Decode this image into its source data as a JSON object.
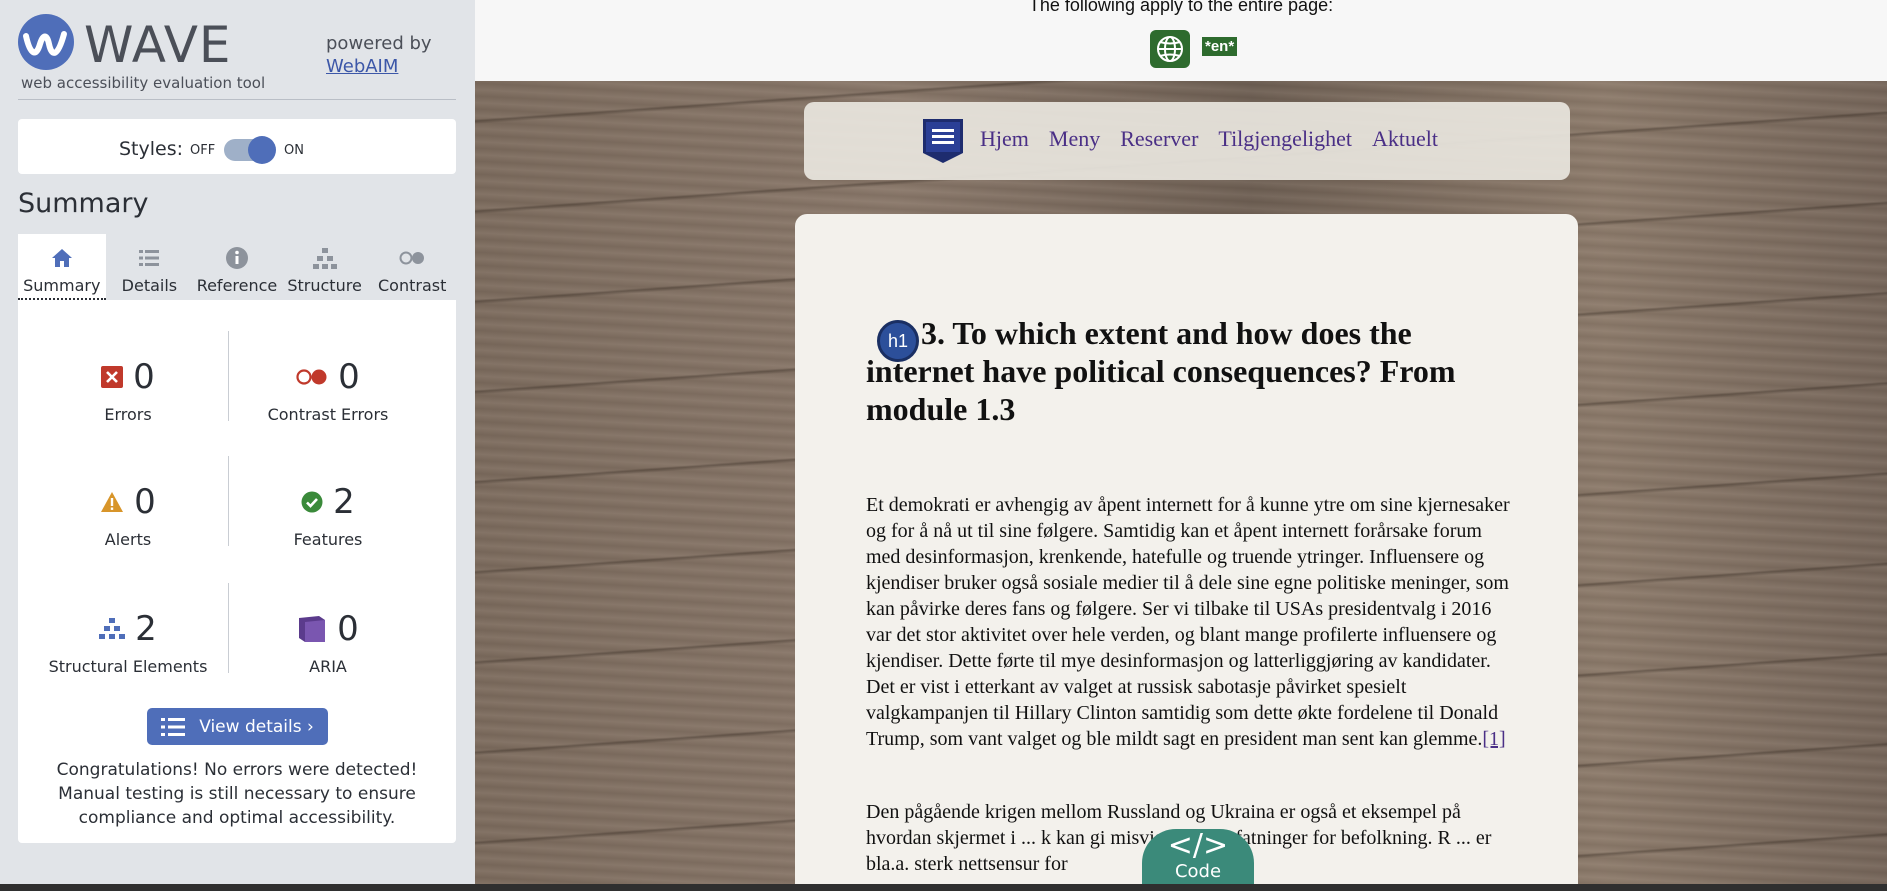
{
  "wave": {
    "logo_text": "WAVE",
    "tagline": "web accessibility evaluation tool",
    "powered_by": "powered by",
    "webaim_link": "WebAIM"
  },
  "styles": {
    "label": "Styles:",
    "off": "OFF",
    "on": "ON",
    "state": "on"
  },
  "summary_heading": "Summary",
  "tabs": [
    {
      "label": "Summary",
      "icon": "home-icon",
      "active": true
    },
    {
      "label": "Details",
      "icon": "list-icon",
      "active": false
    },
    {
      "label": "Reference",
      "icon": "info-icon",
      "active": false
    },
    {
      "label": "Structure",
      "icon": "hierarchy-icon",
      "active": false
    },
    {
      "label": "Contrast",
      "icon": "contrast-icon",
      "active": false
    }
  ],
  "stats": {
    "errors": {
      "count": "0",
      "label": "Errors"
    },
    "contrast_errors": {
      "count": "0",
      "label": "Contrast Errors"
    },
    "alerts": {
      "count": "0",
      "label": "Alerts"
    },
    "features": {
      "count": "2",
      "label": "Features"
    },
    "structural": {
      "count": "2",
      "label": "Structural Elements"
    },
    "aria": {
      "count": "0",
      "label": "ARIA"
    }
  },
  "view_details": "View details ›",
  "congrats": "Congratulations! No errors were detected! Manual testing is still necessary to ensure compliance and optimal accessibility.",
  "page_top": {
    "apply_text": "The following apply to the entire page:",
    "lang_tag": "*en*"
  },
  "site": {
    "nav": [
      "Hjem",
      "Meny",
      "Reserver",
      "Tilgjengelighet",
      "Aktuelt"
    ],
    "h1_badge": "h1",
    "heading": "3. To which extent and how does the internet have political consequences? From module 1.3",
    "paragraph1": "Et demokrati er avhengig av åpent internett for å kunne ytre om sine kjernesaker og for å nå ut til sine følgere. Samtidig kan et åpent internett forårsake forum med desinformasjon, krenkende, hatefulle og truende ytringer. Influensere og kjendiser bruker også sosiale medier til å dele sine egne politiske meninger, som kan påvirke deres fans og følgere. Ser vi tilbake til USAs presidentvalg i 2016 var det stor aktivitet over hele verden, og blant mange profilerte influensere og kjendiser. Dette førte til mye desinformasjon og latterliggjøring av kandidater. Det er vist i etterkant av valget at russisk sabotasje påvirket spesielt valgkampanjen til Hillary Clinton samtidig som dette økte fordelene til Donald Trump, som vant valget og ble mildt sagt en president man sent kan glemme.",
    "footnote": "[1]",
    "paragraph2": "Den pågående krigen mellom Russland og Ukraina er også et eksempel på hvordan skjermet i ... k kan gi misvisende oppfatninger for befolkning. R ... er bla.a. sterk nettsensur for",
    "code_button": "Code",
    "code_glyph": "</>"
  },
  "colors": {
    "wave_blue": "#4f6eb9",
    "error_red": "#c0392b",
    "alert_orange": "#d8952a",
    "feature_green": "#3a8a3a",
    "aria_purple": "#5b3b8c",
    "lang_green": "#2e6b2e",
    "code_teal": "#3b8a7a"
  }
}
